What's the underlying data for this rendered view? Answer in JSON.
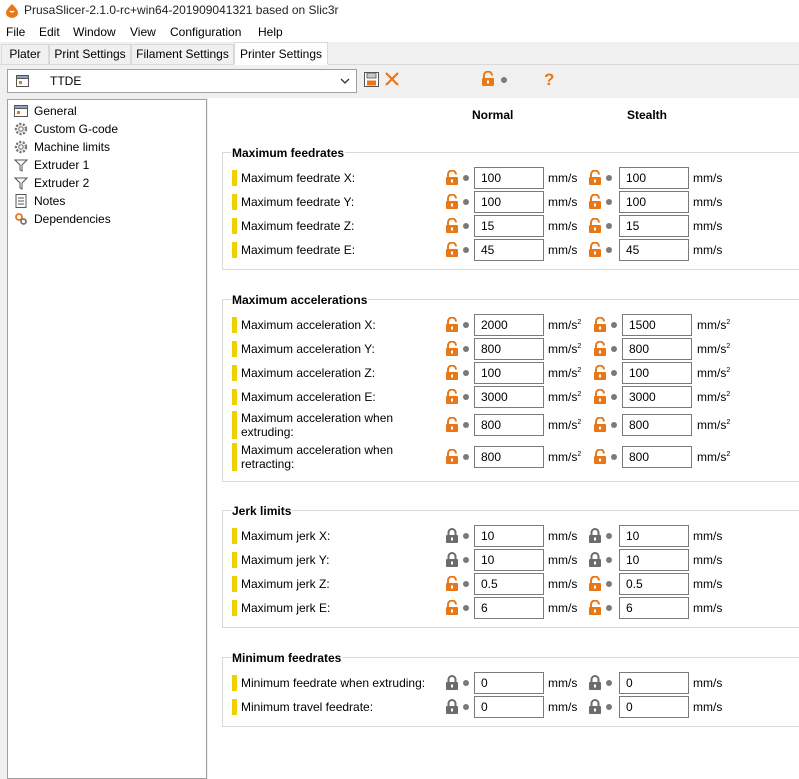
{
  "window": {
    "title": "PrusaSlicer-2.1.0-rc+win64-201909041321 based on Slic3r"
  },
  "menu": [
    "File",
    "Edit",
    "Window",
    "View",
    "Configuration",
    "Help"
  ],
  "tabs": [
    {
      "label": "Plater",
      "active": false
    },
    {
      "label": "Print Settings",
      "active": false
    },
    {
      "label": "Filament Settings",
      "active": false
    },
    {
      "label": "Printer Settings",
      "active": true
    }
  ],
  "preset": {
    "name": "TTDE"
  },
  "tree": [
    {
      "label": "General",
      "icon": "printer-icon"
    },
    {
      "label": "Custom G-code",
      "icon": "cog-icon"
    },
    {
      "label": "Machine limits",
      "icon": "cog-icon",
      "selected": true
    },
    {
      "label": "Extruder 1",
      "icon": "funnel-icon"
    },
    {
      "label": "Extruder 2",
      "icon": "funnel-icon"
    },
    {
      "label": "Notes",
      "icon": "note-icon"
    },
    {
      "label": "Dependencies",
      "icon": "wrench-icon"
    }
  ],
  "columns": {
    "normal": "Normal",
    "stealth": "Stealth"
  },
  "colors": {
    "accent_orange": "#e87817",
    "marker_yellow": "#f1d000",
    "lock_gray": "#6b6b6b"
  },
  "groups": [
    {
      "title": "Maximum feedrates",
      "rows": [
        {
          "label": "Maximum feedrate X:",
          "normal": "100",
          "stealth": "100",
          "unit": "mm/s",
          "locked": false
        },
        {
          "label": "Maximum feedrate Y:",
          "normal": "100",
          "stealth": "100",
          "unit": "mm/s",
          "locked": false
        },
        {
          "label": "Maximum feedrate Z:",
          "normal": "15",
          "stealth": "15",
          "unit": "mm/s",
          "locked": false
        },
        {
          "label": "Maximum feedrate E:",
          "normal": "45",
          "stealth": "45",
          "unit": "mm/s",
          "locked": false
        }
      ]
    },
    {
      "title": "Maximum accelerations",
      "rows": [
        {
          "label": "Maximum acceleration X:",
          "normal": "2000",
          "stealth": "1500",
          "unit": "mm/s",
          "unit_sup": "2",
          "locked": false
        },
        {
          "label": "Maximum acceleration Y:",
          "normal": "800",
          "stealth": "800",
          "unit": "mm/s",
          "unit_sup": "2",
          "locked": false
        },
        {
          "label": "Maximum acceleration Z:",
          "normal": "100",
          "stealth": "100",
          "unit": "mm/s",
          "unit_sup": "2",
          "locked": false
        },
        {
          "label": "Maximum acceleration E:",
          "normal": "3000",
          "stealth": "3000",
          "unit": "mm/s",
          "unit_sup": "2",
          "locked": false
        },
        {
          "label": "Maximum acceleration when extruding:",
          "normal": "800",
          "stealth": "800",
          "unit": "mm/s",
          "unit_sup": "2",
          "locked": false
        },
        {
          "label": "Maximum acceleration when retracting:",
          "normal": "800",
          "stealth": "800",
          "unit": "mm/s",
          "unit_sup": "2",
          "locked": false
        }
      ]
    },
    {
      "title": "Jerk limits",
      "rows": [
        {
          "label": "Maximum jerk X:",
          "normal": "10",
          "stealth": "10",
          "unit": "mm/s",
          "locked": true
        },
        {
          "label": "Maximum jerk Y:",
          "normal": "10",
          "stealth": "10",
          "unit": "mm/s",
          "locked": true
        },
        {
          "label": "Maximum jerk Z:",
          "normal": "0.5",
          "stealth": "0.5",
          "unit": "mm/s",
          "locked": false
        },
        {
          "label": "Maximum jerk E:",
          "normal": "6",
          "stealth": "6",
          "unit": "mm/s",
          "locked": false
        }
      ]
    },
    {
      "title": "Minimum feedrates",
      "rows": [
        {
          "label": "Minimum feedrate when extruding:",
          "normal": "0",
          "stealth": "0",
          "unit": "mm/s",
          "locked": true
        },
        {
          "label": "Minimum travel feedrate:",
          "normal": "0",
          "stealth": "0",
          "unit": "mm/s",
          "locked": true
        }
      ]
    }
  ]
}
